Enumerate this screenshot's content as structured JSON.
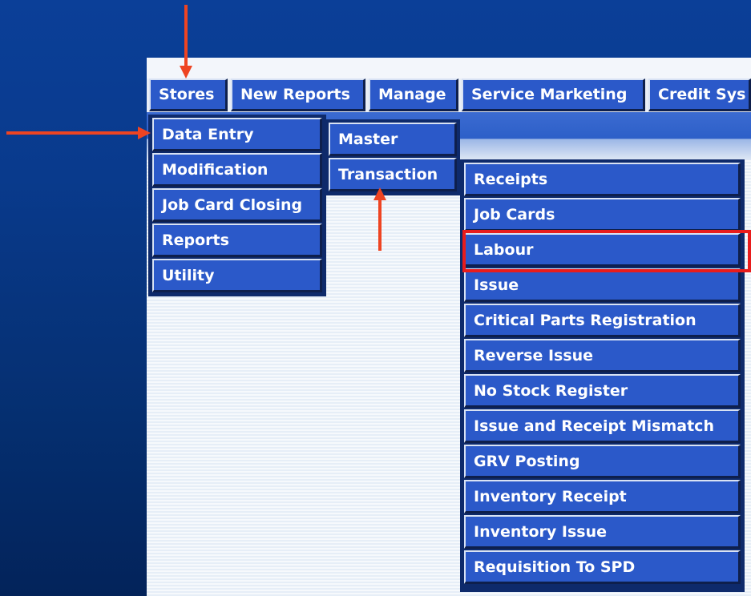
{
  "menubar": {
    "items": [
      {
        "label": "Stores"
      },
      {
        "label": "New Reports"
      },
      {
        "label": "Manage"
      },
      {
        "label": "Service Marketing"
      },
      {
        "label": "Credit Sys"
      }
    ]
  },
  "stores_menu": {
    "items": [
      {
        "label": "Data Entry"
      },
      {
        "label": "Modification"
      },
      {
        "label": "Job Card Closing"
      },
      {
        "label": "Reports"
      },
      {
        "label": "Utility"
      }
    ]
  },
  "data_entry_menu": {
    "items": [
      {
        "label": "Master"
      },
      {
        "label": "Transaction"
      }
    ]
  },
  "transaction_menu": {
    "items": [
      {
        "label": "Receipts"
      },
      {
        "label": "Job Cards"
      },
      {
        "label": "Labour"
      },
      {
        "label": "Issue"
      },
      {
        "label": "Critical Parts Registration"
      },
      {
        "label": "Reverse Issue"
      },
      {
        "label": "No Stock Register"
      },
      {
        "label": "Issue and Receipt Mismatch"
      },
      {
        "label": "GRV Posting"
      },
      {
        "label": "Inventory Receipt"
      },
      {
        "label": "Inventory Issue"
      },
      {
        "label": "Requisition To SPD"
      }
    ]
  },
  "colors": {
    "menu_button": "#2b59c9",
    "annotation_arrow": "#ee4422",
    "highlight_box": "#e81c1c"
  }
}
